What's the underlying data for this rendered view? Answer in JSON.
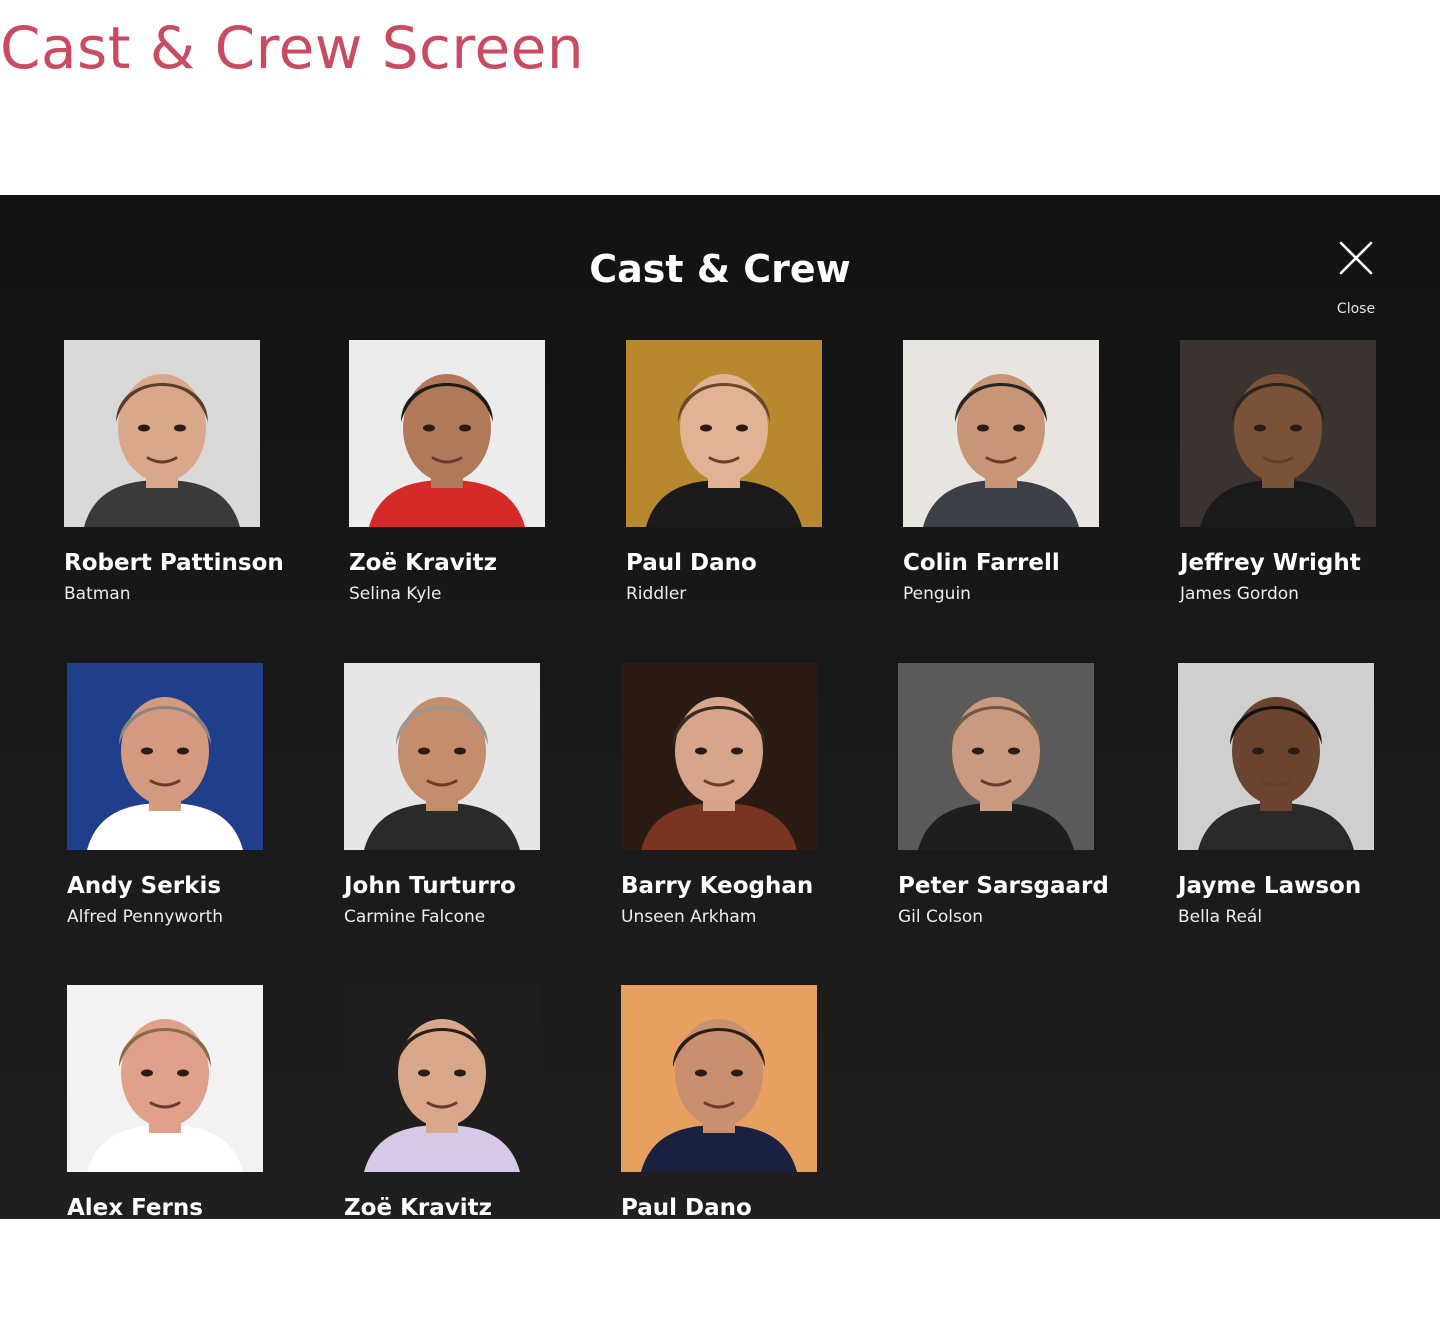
{
  "page": {
    "heading": "Cast & Crew Screen"
  },
  "modal": {
    "title": "Cast & Crew",
    "close_label": "Close"
  },
  "cast": [
    {
      "name": "Robert Pattinson",
      "role": "Batman",
      "bg": "#d9d9d9",
      "skin": "#d9a88a",
      "hair": "#5a3e2b",
      "cloth": "#3a3a3a"
    },
    {
      "name": "Zoë Kravitz",
      "role": "Selina Kyle",
      "bg": "#ececec",
      "skin": "#b07a5a",
      "hair": "#1e1a18",
      "cloth": "#d42a2a"
    },
    {
      "name": "Paul Dano",
      "role": "Riddler",
      "bg": "#b8882e",
      "skin": "#e0b394",
      "hair": "#6b4a2c",
      "cloth": "#1a1a1a"
    },
    {
      "name": "Colin Farrell",
      "role": "Penguin",
      "bg": "#e8e4e0",
      "skin": "#c99577",
      "hair": "#2a2420",
      "cloth": "#3c3f48"
    },
    {
      "name": "Jeffrey Wright",
      "role": "James Gordon",
      "bg": "#3a3330",
      "skin": "#7a5238",
      "hair": "#2a2420",
      "cloth": "#1a1a1a"
    },
    {
      "name": "Andy Serkis",
      "role": "Alfred Pennyworth",
      "bg": "#1f3f8a",
      "skin": "#d49a80",
      "hair": "#8a8580",
      "cloth": "#ffffff"
    },
    {
      "name": "John Turturro",
      "role": "Carmine Falcone",
      "bg": "#e6e6e6",
      "skin": "#c48d6c",
      "hair": "#9a9690",
      "cloth": "#2a2a2a"
    },
    {
      "name": "Barry Keoghan",
      "role": "Unseen Arkham",
      "bg": "#2a1a14",
      "skin": "#d6a58a",
      "hair": "#3a2a1e",
      "cloth": "#7a3520"
    },
    {
      "name": "Peter Sarsgaard",
      "role": "Gil Colson",
      "bg": "#5a5a5a",
      "skin": "#c99a80",
      "hair": "#6e5a48",
      "cloth": "#1e1e1e"
    },
    {
      "name": "Jayme Lawson",
      "role": "Bella Reál",
      "bg": "#cfcfcf",
      "skin": "#6b4430",
      "hair": "#141010",
      "cloth": "#2a2a2a"
    },
    {
      "name": "Alex Ferns",
      "role": "",
      "bg": "#f2f2f2",
      "skin": "#e0a08a",
      "hair": "#8a6a48",
      "cloth": "#ffffff"
    },
    {
      "name": "Zoë Kravitz",
      "role": "",
      "bg": "#1e1e1e",
      "skin": "#d9a88a",
      "hair": "#2a1e16",
      "cloth": "#d8c8e8"
    },
    {
      "name": "Paul Dano",
      "role": "",
      "bg": "#e8a060",
      "skin": "#c99070",
      "hair": "#2a1e16",
      "cloth": "#1a2040"
    }
  ]
}
